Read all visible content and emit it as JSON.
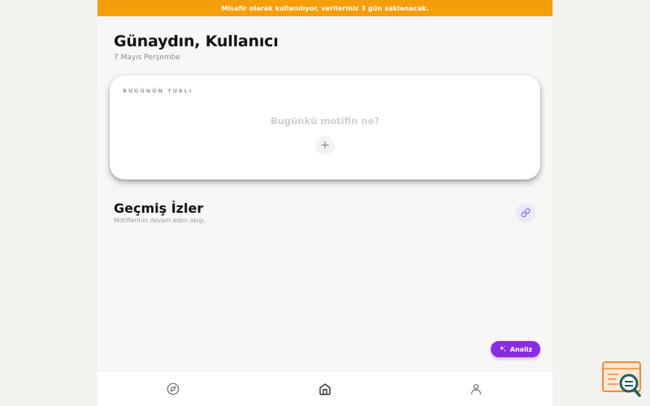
{
  "banner": {
    "text": "Misafir olarak kullanılıyor, verileriniz 3 gün saklanacak."
  },
  "header": {
    "greeting": "Günaydın, Kullanıcı",
    "date": "7 Mayıs Perşembe"
  },
  "canvas": {
    "label": "BUGÜNÜN TUALI",
    "prompt": "Bugünkü motifin ne?",
    "add_symbol": "+"
  },
  "history": {
    "title": "Geçmiş İzler",
    "subtitle": "Motiflerinin devam eden akışı."
  },
  "fab": {
    "label": "Analiz",
    "icon": "sparkles-icon"
  },
  "nav": {
    "items": [
      {
        "name": "explore",
        "icon": "compass-icon"
      },
      {
        "name": "home",
        "icon": "home-icon",
        "active": true
      },
      {
        "name": "profile",
        "icon": "user-icon"
      }
    ]
  },
  "colors": {
    "banner": "#f59e0b",
    "accent": "#8b2be2",
    "background": "#f8f7f5",
    "card": "#ffffff"
  }
}
